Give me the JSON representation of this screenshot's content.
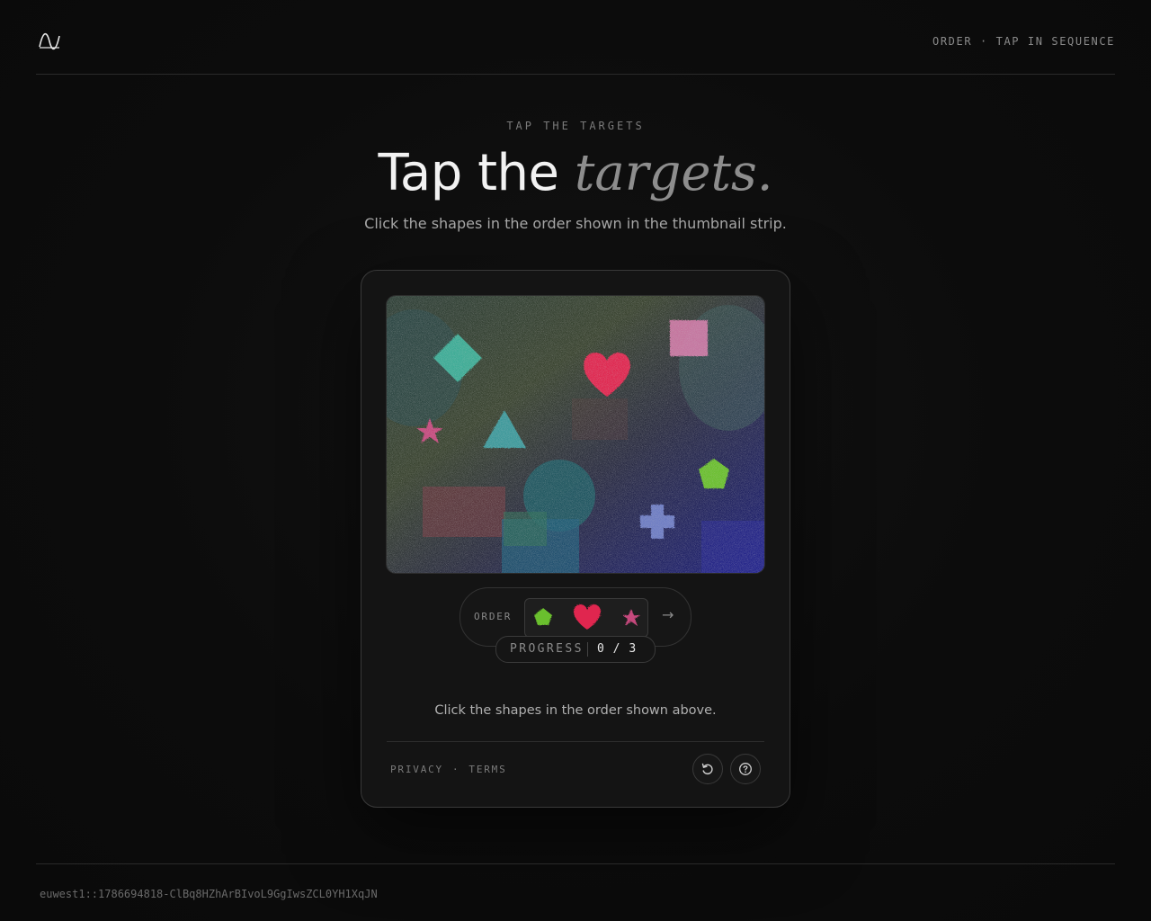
{
  "header": {
    "logo_icon": "wave-logo-icon",
    "mode_label": "ORDER · TAP IN SEQUENCE"
  },
  "hero": {
    "eyebrow": "TAP THE TARGETS",
    "headline_main": "Tap the",
    "headline_accent": "targets.",
    "subtitle": "Click the shapes in the order shown in the thumbnail strip."
  },
  "challenge": {
    "canvas_shapes": [
      {
        "shape": "diamond",
        "color": "#3fb7a0"
      },
      {
        "shape": "heart",
        "color": "#e0264f"
      },
      {
        "shape": "square",
        "color": "#d57aa9"
      },
      {
        "shape": "star",
        "color": "#c6487d"
      },
      {
        "shape": "triangle",
        "color": "#3fa3a6"
      },
      {
        "shape": "pentagon",
        "color": "#6bbf2d"
      },
      {
        "shape": "cross",
        "color": "#7a8bd6"
      }
    ],
    "order_label": "ORDER",
    "order_sequence": [
      {
        "shape": "pentagon",
        "color": "#6bbf2d"
      },
      {
        "shape": "heart",
        "color": "#e0264f"
      },
      {
        "shape": "star",
        "color": "#c6487d"
      }
    ],
    "next_icon": "arrow-right-icon",
    "progress_label": "PROGRESS",
    "progress_current": "0",
    "progress_separator": "/",
    "progress_total": "3",
    "instruction": "Click the shapes in the order shown above."
  },
  "card_footer": {
    "privacy": "PRIVACY",
    "separator": "·",
    "terms": "TERMS",
    "refresh_icon": "refresh-icon",
    "help_icon": "help-icon"
  },
  "footer": {
    "session_id": "euwest1::1786694818-ClBq8HZhArBIvoL9GgIwsZCL0YH1XqJN"
  }
}
